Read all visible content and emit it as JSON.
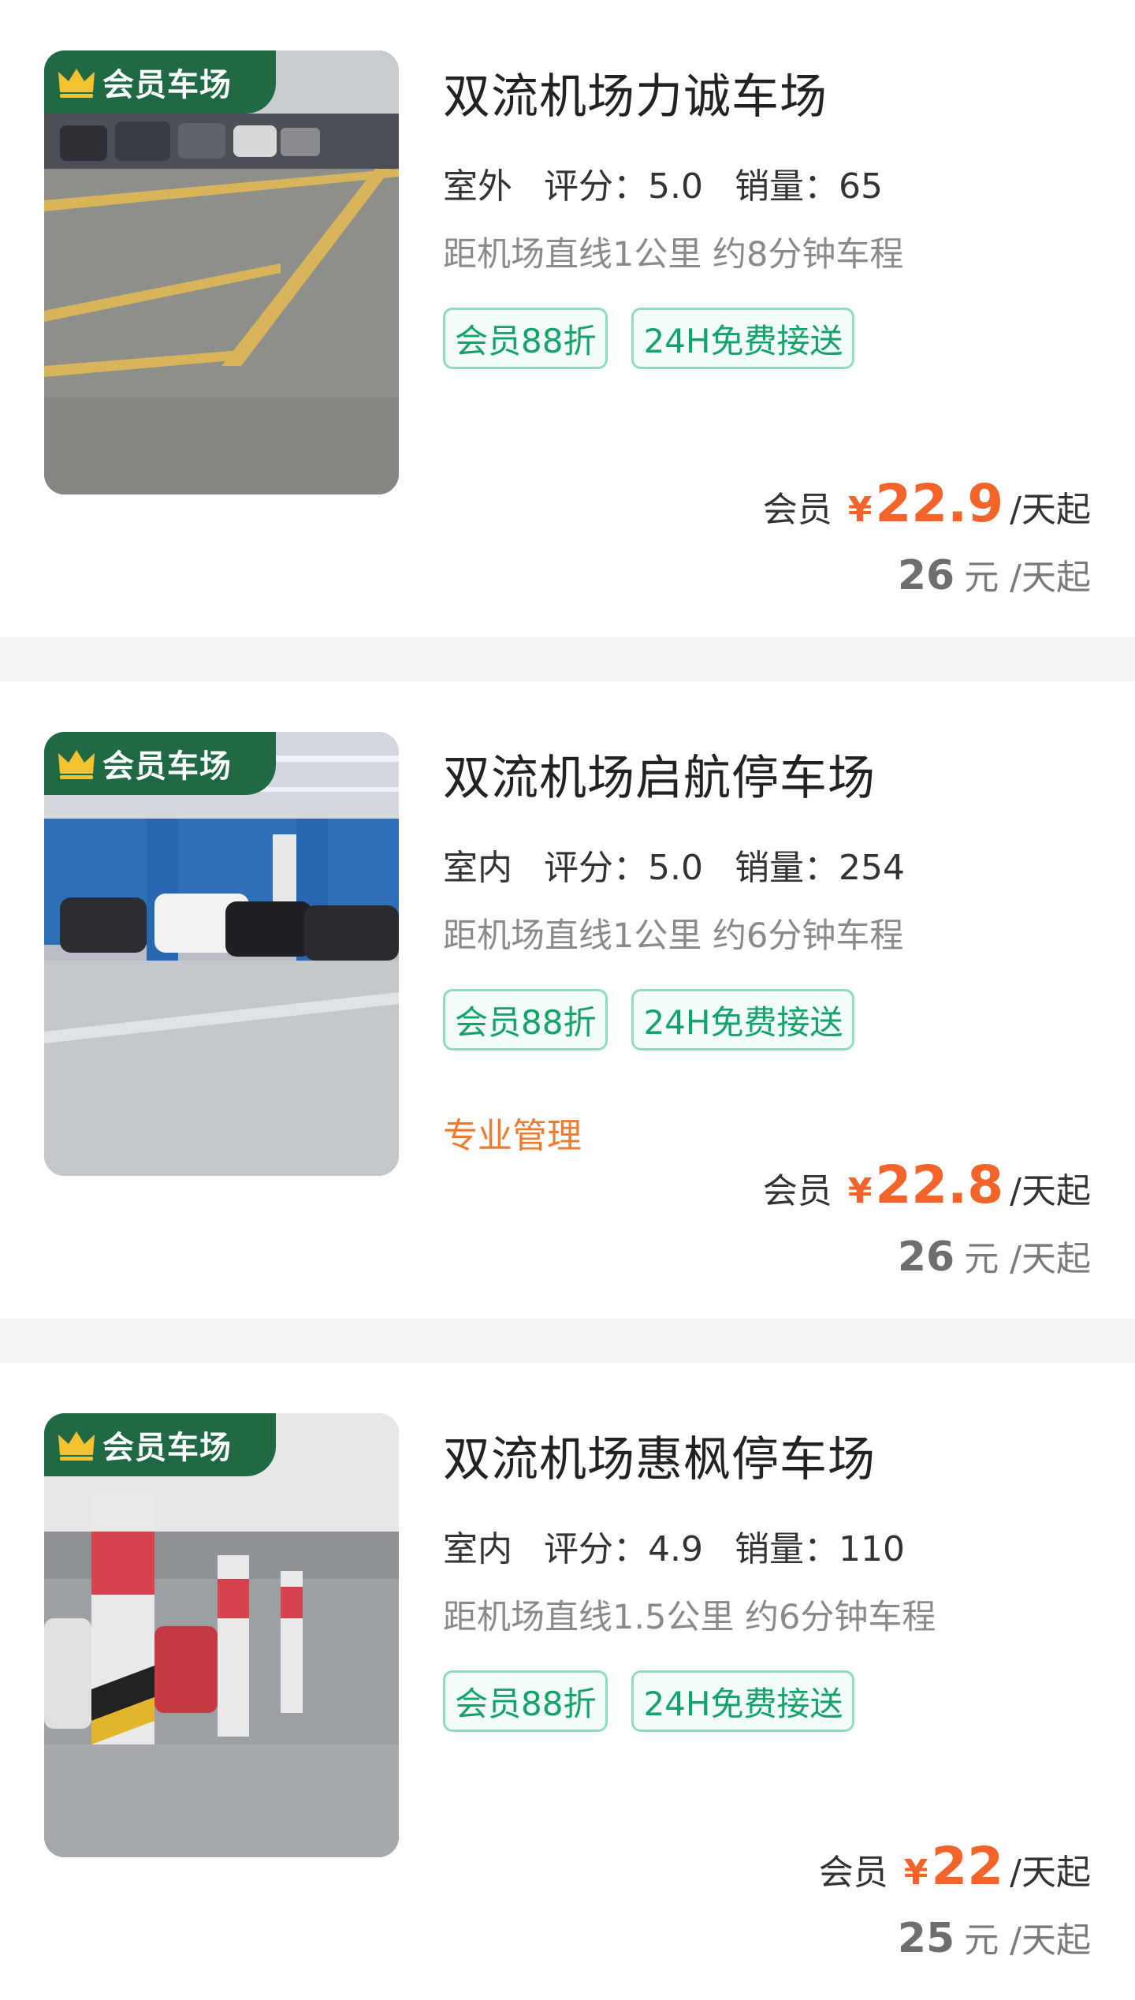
{
  "badge_label": "会员车场",
  "labels": {
    "rating_prefix": "评分：",
    "sales_prefix": "销量：",
    "member": "会员",
    "yen": "¥",
    "per_day": "/天起",
    "orig_unit": "元 /天起"
  },
  "lots": [
    {
      "name": "双流机场力诚车场",
      "location_type": "室外",
      "rating": "5.0",
      "sales": "65",
      "distance": "距机场直线1公里 约8分钟车程",
      "tags": [
        "会员88折",
        "24H免费接送"
      ],
      "extra": "",
      "member_price": "22.9",
      "original_price": "26"
    },
    {
      "name": "双流机场启航停车场",
      "location_type": "室内",
      "rating": "5.0",
      "sales": "254",
      "distance": "距机场直线1公里 约6分钟车程",
      "tags": [
        "会员88折",
        "24H免费接送"
      ],
      "extra": "专业管理",
      "member_price": "22.8",
      "original_price": "26"
    },
    {
      "name": "双流机场惠枫停车场",
      "location_type": "室内",
      "rating": "4.9",
      "sales": "110",
      "distance": "距机场直线1.5公里 约6分钟车程",
      "tags": [
        "会员88折",
        "24H免费接送"
      ],
      "extra": "",
      "member_price": "22",
      "original_price": "25"
    }
  ],
  "colors": {
    "badge_bg": "#1f6a45",
    "crown": "#f2c230",
    "accent_price": "#f2642a",
    "tag_text": "#12a36a",
    "tag_border": "#8fdcc0",
    "extra_text": "#f07a2e"
  }
}
